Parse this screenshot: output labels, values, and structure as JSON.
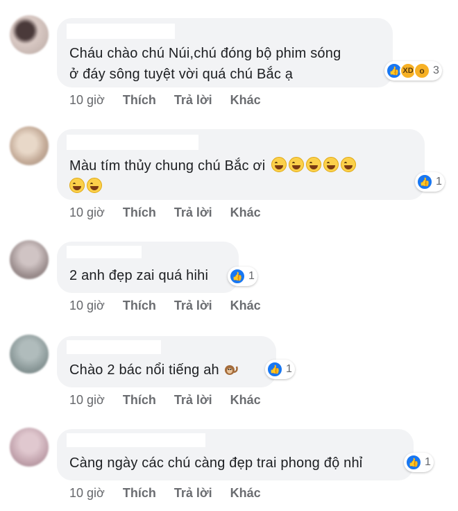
{
  "comments": [
    {
      "text_lines": [
        "Cháu chào chú Núi,chú đóng bộ phim sóng",
        "ở đáy sông tuyệt vời quá chú Bắc ạ"
      ],
      "reaction_count": "3",
      "time": "10 giờ",
      "like": "Thích",
      "reply": "Trả lời",
      "more": "Khác",
      "avatar_color": "#c9b9b4"
    },
    {
      "text_lines": [
        "Màu tím thủy chung chú Bắc ơi"
      ],
      "reaction_count": "1",
      "time": "10 giờ",
      "like": "Thích",
      "reply": "Trả lời",
      "more": "Khác",
      "avatar_color": "#d8c3b2"
    },
    {
      "text_lines": [
        "2 anh đẹp zai quá hihi"
      ],
      "reaction_count": "1",
      "time": "10 giờ",
      "like": "Thích",
      "reply": "Trả lời",
      "more": "Khác",
      "avatar_color": "#a89c9c"
    },
    {
      "text_lines": [
        "Chào 2 bác nổi tiếng ah"
      ],
      "reaction_count": "1",
      "time": "10 giờ",
      "like": "Thích",
      "reply": "Trả lời",
      "more": "Khác",
      "avatar_color": "#9aa7a6"
    },
    {
      "text_lines": [
        "Càng ngày các chú càng đẹp trai phong độ nhỉ"
      ],
      "reaction_count": "1",
      "time": "10 giờ",
      "like": "Thích",
      "reply": "Trả lời",
      "more": "Khác",
      "avatar_color": "#c7a9b3"
    }
  ],
  "colors": {
    "bubble": "#f2f3f5",
    "like_blue": "#1877f2",
    "meta_gray": "#65676b"
  }
}
